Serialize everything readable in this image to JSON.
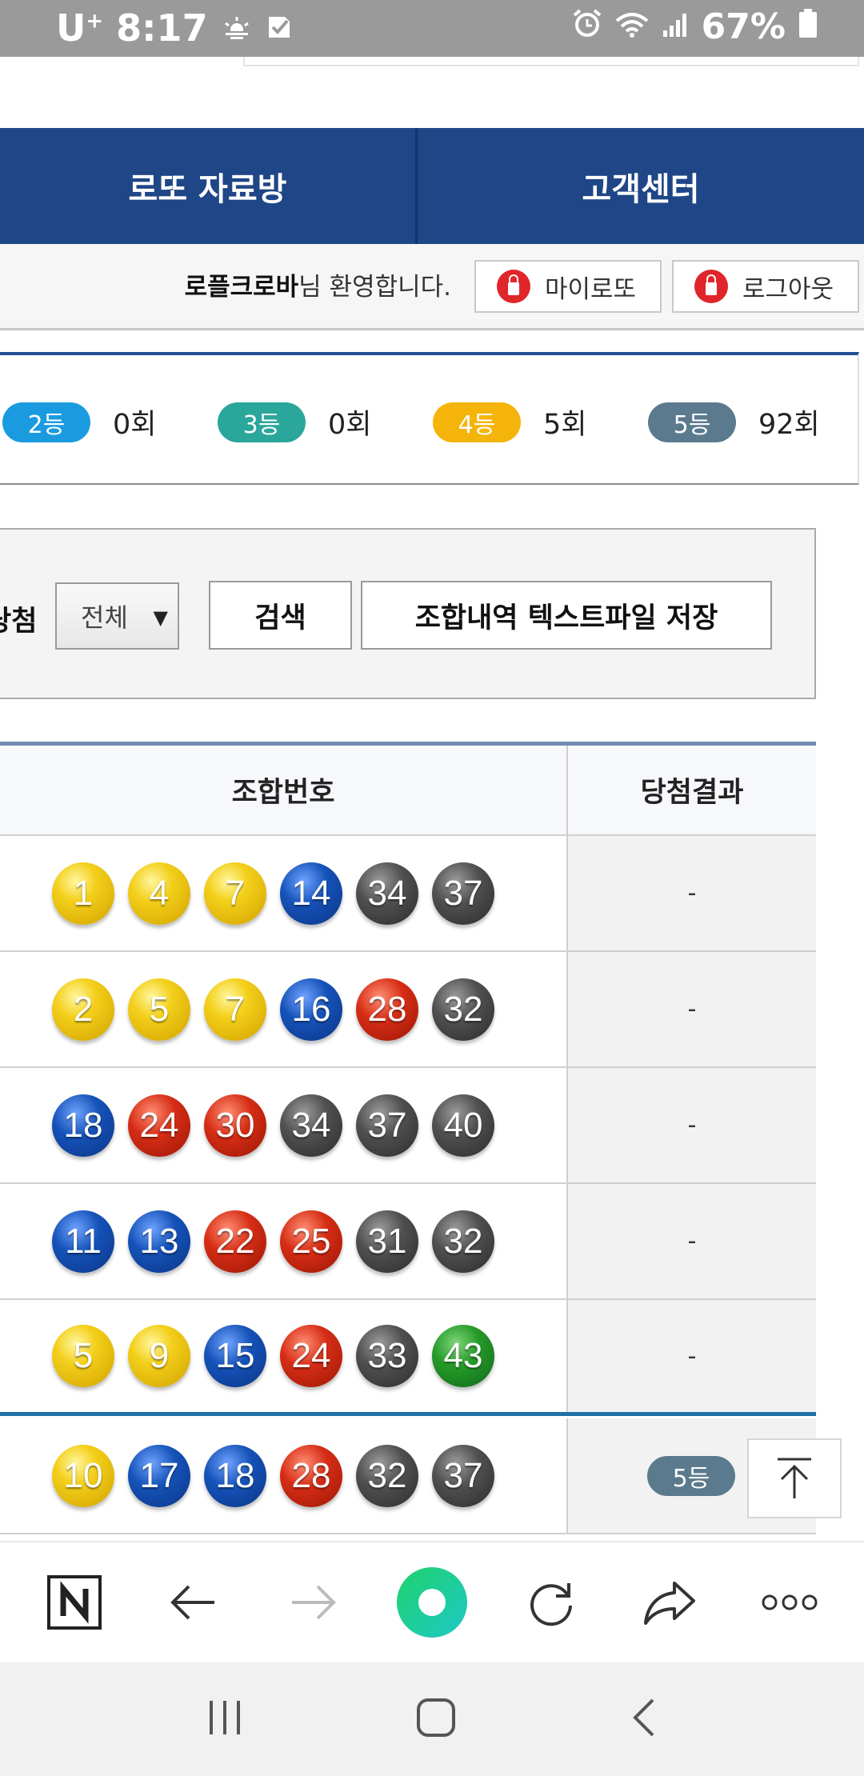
{
  "status_bar": {
    "carrier": "U",
    "carrier_sup": "+",
    "time": "8:17",
    "battery": "67%"
  },
  "nav": {
    "item1": "로또 자료방",
    "item2": "고객센터"
  },
  "user": {
    "name": "로플크로바",
    "welcome_suffix": "님 환영합니다.",
    "my_lotto": "마이로또",
    "logout": "로그아웃"
  },
  "stats": [
    {
      "rank": "2등",
      "count": "0회",
      "color": "#1a9be0"
    },
    {
      "rank": "3등",
      "count": "0회",
      "color": "#2aa69a"
    },
    {
      "rank": "4등",
      "count": "5회",
      "color": "#f5b40a"
    },
    {
      "rank": "5등",
      "count": "92회",
      "color": "#5b7a8e"
    }
  ],
  "search": {
    "label": "당첨",
    "select_value": "전체",
    "search_button": "검색",
    "save_button": "조합내역 텍스트파일 저장"
  },
  "table": {
    "headers": {
      "numbers": "조합번호",
      "result": "당첨결과"
    },
    "rows": [
      {
        "balls": [
          "1",
          "4",
          "7",
          "14",
          "34",
          "37"
        ],
        "result": "-"
      },
      {
        "balls": [
          "2",
          "5",
          "7",
          "16",
          "28",
          "32"
        ],
        "result": "-"
      },
      {
        "balls": [
          "18",
          "24",
          "30",
          "34",
          "37",
          "40"
        ],
        "result": "-"
      },
      {
        "balls": [
          "11",
          "13",
          "22",
          "25",
          "31",
          "32"
        ],
        "result": "-"
      },
      {
        "balls": [
          "5",
          "9",
          "15",
          "24",
          "33",
          "43"
        ],
        "result": "-"
      },
      {
        "balls": [
          "10",
          "17",
          "18",
          "28",
          "32",
          "37"
        ],
        "result": "5등"
      }
    ]
  },
  "icons": {
    "naver": "naver-n-icon",
    "back": "arrow-left-icon",
    "forward": "arrow-right-icon",
    "home": "green-circle-icon",
    "refresh": "refresh-icon",
    "share": "share-icon",
    "more": "more-icon",
    "to_top": "scroll-to-top-icon"
  }
}
